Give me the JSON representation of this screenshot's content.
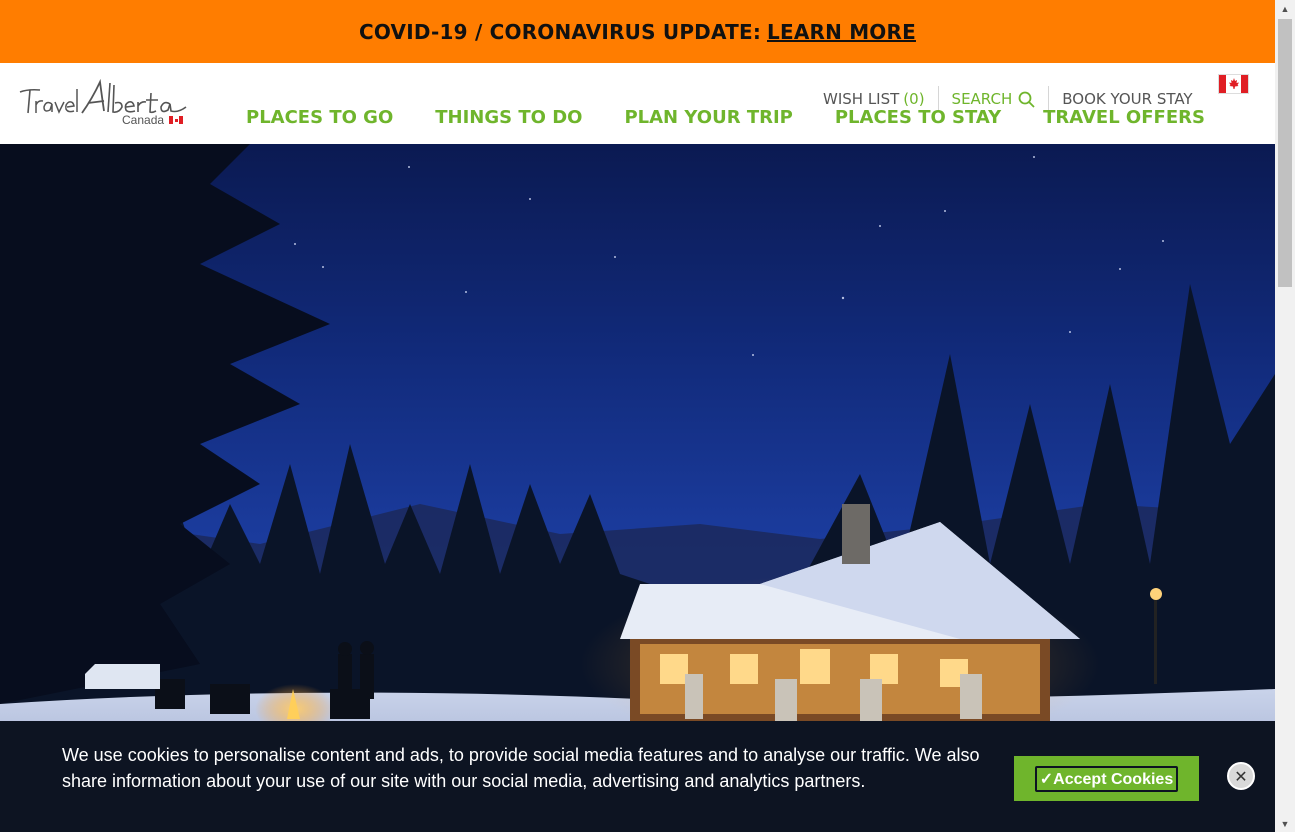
{
  "alert": {
    "text": "COVID-19 / CORONAVIRUS UPDATE:",
    "link": "LEARN MORE"
  },
  "logo": {
    "wordmark": "Travel Alberta",
    "sub": "Canada"
  },
  "utility_nav": {
    "wish_list": "WISH LIST",
    "wish_count": "(0)",
    "search": "SEARCH",
    "book": "BOOK YOUR STAY"
  },
  "main_nav": {
    "items": [
      {
        "label": "PLACES TO GO"
      },
      {
        "label": "THINGS TO DO"
      },
      {
        "label": "PLAN YOUR TRIP"
      },
      {
        "label": "PLACES TO STAY"
      },
      {
        "label": "TRAVEL OFFERS"
      }
    ]
  },
  "cookie": {
    "message": "We use cookies to personalise content and ads, to provide social media features and to analyse our traffic. We also share information about your use of our site with our social media, advertising and analytics partners.",
    "accept": "✓Accept Cookies",
    "close": "✕"
  },
  "colors": {
    "alert_bg": "#ff7d00",
    "brand_green": "#6fb52c",
    "cookie_bg": "#0d1422",
    "flag_red": "#e01e24"
  },
  "icons": {
    "search": "search-icon",
    "flag": "canada-flag-icon",
    "close": "close-icon"
  }
}
